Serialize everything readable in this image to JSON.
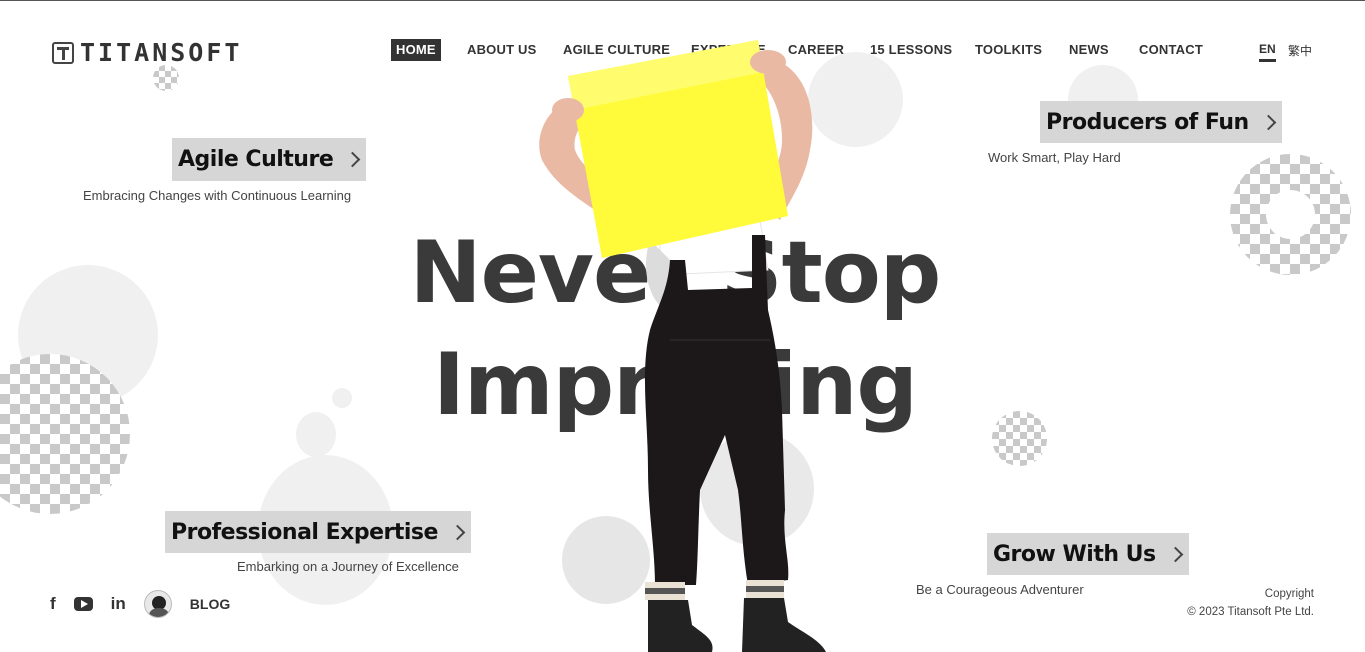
{
  "brand": {
    "logo_text": "TITANSOFT"
  },
  "nav": {
    "items": [
      {
        "label": "HOME",
        "active": true
      },
      {
        "label": "ABOUT US",
        "active": false
      },
      {
        "label": "AGILE CULTURE",
        "active": false
      },
      {
        "label": "EXPERTISE",
        "active": false
      },
      {
        "label": "CAREER",
        "active": false
      },
      {
        "label": "15 LESSONS",
        "active": false
      },
      {
        "label": "TOOLKITS",
        "active": false
      },
      {
        "label": "NEWS",
        "active": false
      },
      {
        "label": "CONTACT",
        "active": false
      }
    ]
  },
  "language": {
    "current": "EN",
    "alternate": "繁中"
  },
  "hero": {
    "line1": "Never Stop",
    "line2": "Improving"
  },
  "callouts": {
    "agile": {
      "title": "Agile Culture",
      "subtitle": "Embracing Changes with Continuous Learning"
    },
    "fun": {
      "title": "Producers of Fun",
      "subtitle": "Work Smart, Play Hard"
    },
    "expertise": {
      "title": "Professional Expertise",
      "subtitle": "Embarking on a Journey of Excellence"
    },
    "grow": {
      "title": "Grow With Us",
      "subtitle": "Be a Courageous Adventurer"
    }
  },
  "social": {
    "facebook": "f",
    "linkedin": "in",
    "blog_label": "BLOG"
  },
  "footer": {
    "copyright_label": "Copyright",
    "copyright_text": "© 2023 Titansoft Pte Ltd."
  },
  "colors": {
    "accent_yellow": "#fffb3a",
    "text_dark": "#333333",
    "callout_bg": "#d6d6d6"
  }
}
